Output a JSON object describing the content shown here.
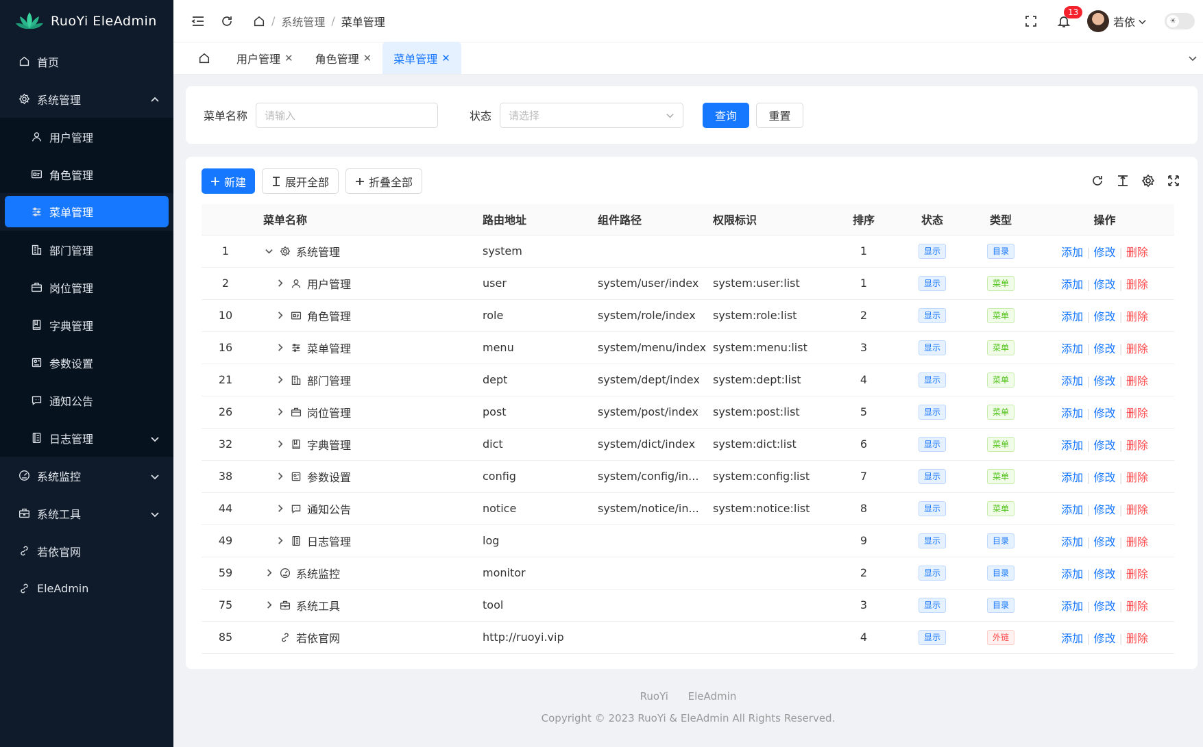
{
  "app": {
    "title": "RuoYi EleAdmin"
  },
  "sidebar": {
    "items": [
      {
        "label": "首页",
        "icon": "home-icon"
      },
      {
        "label": "系统管理",
        "icon": "gear-icon",
        "expanded": true
      },
      {
        "label": "用户管理",
        "icon": "user-icon"
      },
      {
        "label": "角色管理",
        "icon": "id-card-icon"
      },
      {
        "label": "菜单管理",
        "icon": "sliders-icon",
        "active": true
      },
      {
        "label": "部门管理",
        "icon": "building-icon"
      },
      {
        "label": "岗位管理",
        "icon": "briefcase-icon"
      },
      {
        "label": "字典管理",
        "icon": "book-icon"
      },
      {
        "label": "参数设置",
        "icon": "config-icon"
      },
      {
        "label": "通知公告",
        "icon": "message-icon"
      },
      {
        "label": "日志管理",
        "icon": "log-icon"
      },
      {
        "label": "系统监控",
        "icon": "monitor-icon"
      },
      {
        "label": "系统工具",
        "icon": "toolbox-icon"
      },
      {
        "label": "若依官网",
        "icon": "link-icon"
      },
      {
        "label": "EleAdmin",
        "icon": "link-icon"
      }
    ]
  },
  "header": {
    "breadcrumb": [
      "系统管理",
      "菜单管理"
    ],
    "notification_count": "13",
    "username": "若依"
  },
  "tabs": [
    {
      "label": "用户管理"
    },
    {
      "label": "角色管理"
    },
    {
      "label": "菜单管理",
      "active": true
    }
  ],
  "search": {
    "name_label": "菜单名称",
    "name_placeholder": "请输入",
    "status_label": "状态",
    "status_placeholder": "请选择",
    "query_label": "查询",
    "reset_label": "重置"
  },
  "toolbar": {
    "new_label": "新建",
    "expand_label": "展开全部",
    "collapse_label": "折叠全部"
  },
  "table": {
    "columns": [
      "菜单名称",
      "路由地址",
      "组件路径",
      "权限标识",
      "排序",
      "状态",
      "类型",
      "操作"
    ],
    "actions": {
      "add": "添加",
      "edit": "修改",
      "delete": "删除"
    },
    "rows": [
      {
        "id": "1",
        "name": "系统管理",
        "icon": "gear-icon",
        "level": 0,
        "caret": "down",
        "path": "system",
        "component": "",
        "perm": "",
        "sort": "1",
        "status": "显示",
        "type": "目录",
        "type_color": "blue"
      },
      {
        "id": "2",
        "name": "用户管理",
        "icon": "user-icon",
        "level": 1,
        "caret": "right",
        "path": "user",
        "component": "system/user/index",
        "perm": "system:user:list",
        "sort": "1",
        "status": "显示",
        "type": "菜单",
        "type_color": "green"
      },
      {
        "id": "10",
        "name": "角色管理",
        "icon": "id-card-icon",
        "level": 1,
        "caret": "right",
        "path": "role",
        "component": "system/role/index",
        "perm": "system:role:list",
        "sort": "2",
        "status": "显示",
        "type": "菜单",
        "type_color": "green"
      },
      {
        "id": "16",
        "name": "菜单管理",
        "icon": "sliders-icon",
        "level": 1,
        "caret": "right",
        "path": "menu",
        "component": "system/menu/index",
        "perm": "system:menu:list",
        "sort": "3",
        "status": "显示",
        "type": "菜单",
        "type_color": "green"
      },
      {
        "id": "21",
        "name": "部门管理",
        "icon": "building-icon",
        "level": 1,
        "caret": "right",
        "path": "dept",
        "component": "system/dept/index",
        "perm": "system:dept:list",
        "sort": "4",
        "status": "显示",
        "type": "菜单",
        "type_color": "green"
      },
      {
        "id": "26",
        "name": "岗位管理",
        "icon": "briefcase-icon",
        "level": 1,
        "caret": "right",
        "path": "post",
        "component": "system/post/index",
        "perm": "system:post:list",
        "sort": "5",
        "status": "显示",
        "type": "菜单",
        "type_color": "green"
      },
      {
        "id": "32",
        "name": "字典管理",
        "icon": "book-icon",
        "level": 1,
        "caret": "right",
        "path": "dict",
        "component": "system/dict/index",
        "perm": "system:dict:list",
        "sort": "6",
        "status": "显示",
        "type": "菜单",
        "type_color": "green"
      },
      {
        "id": "38",
        "name": "参数设置",
        "icon": "config-icon",
        "level": 1,
        "caret": "right",
        "path": "config",
        "component": "system/config/in...",
        "perm": "system:config:list",
        "sort": "7",
        "status": "显示",
        "type": "菜单",
        "type_color": "green"
      },
      {
        "id": "44",
        "name": "通知公告",
        "icon": "message-icon",
        "level": 1,
        "caret": "right",
        "path": "notice",
        "component": "system/notice/in...",
        "perm": "system:notice:list",
        "sort": "8",
        "status": "显示",
        "type": "菜单",
        "type_color": "green"
      },
      {
        "id": "49",
        "name": "日志管理",
        "icon": "log-icon",
        "level": 1,
        "caret": "right",
        "path": "log",
        "component": "",
        "perm": "",
        "sort": "9",
        "status": "显示",
        "type": "目录",
        "type_color": "blue"
      },
      {
        "id": "59",
        "name": "系统监控",
        "icon": "monitor-icon",
        "level": 0,
        "caret": "right",
        "path": "monitor",
        "component": "",
        "perm": "",
        "sort": "2",
        "status": "显示",
        "type": "目录",
        "type_color": "blue"
      },
      {
        "id": "75",
        "name": "系统工具",
        "icon": "toolbox-icon",
        "level": 0,
        "caret": "right",
        "path": "tool",
        "component": "",
        "perm": "",
        "sort": "3",
        "status": "显示",
        "type": "目录",
        "type_color": "blue"
      },
      {
        "id": "85",
        "name": "若依官网",
        "icon": "link-icon",
        "level": 0,
        "caret": "none",
        "path": "http://ruoyi.vip",
        "component": "",
        "perm": "",
        "sort": "4",
        "status": "显示",
        "type": "外链",
        "type_color": "red"
      }
    ]
  },
  "footer": {
    "links": [
      "RuoYi",
      "EleAdmin"
    ],
    "copyright": "Copyright © 2023 RuoYi & EleAdmin All Rights Reserved."
  },
  "colors": {
    "primary": "#1677ff",
    "sidebar_bg": "#0f1b2a",
    "danger": "#ff4d4f",
    "success": "#52c41a"
  }
}
